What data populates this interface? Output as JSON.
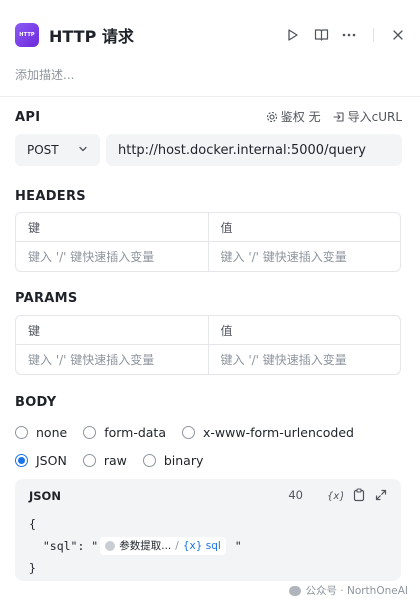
{
  "header": {
    "app_icon_text": "HTTP",
    "title": "HTTP 请求",
    "icons": [
      "play-icon",
      "book-icon",
      "more-icon",
      "close-icon"
    ]
  },
  "description_placeholder": "添加描述...",
  "api": {
    "title": "API",
    "auth_label": "鉴权 无",
    "import_label": "导入cURL",
    "method": "POST",
    "url": "http://host.docker.internal:5000/query"
  },
  "headers": {
    "title": "HEADERS",
    "col_key": "键",
    "col_value": "值",
    "key_placeholder": "键入 '/' 键快速插入变量",
    "value_placeholder": "键入 '/' 键快速插入变量"
  },
  "params": {
    "title": "PARAMS",
    "col_key": "键",
    "col_value": "值",
    "key_placeholder": "键入 '/' 键快速插入变量",
    "value_placeholder": "键入 '/' 键快速插入变量"
  },
  "body": {
    "title": "BODY",
    "options_row1": [
      "none",
      "form-data",
      "x-www-form-urlencoded"
    ],
    "options_row2": [
      "JSON",
      "raw",
      "binary"
    ],
    "selected": "JSON",
    "editor": {
      "title": "JSON",
      "count": "40",
      "line1": "{",
      "line2_prefix": "  \"sql\": \"",
      "chip_node": "参数提取...",
      "chip_sep": "/",
      "chip_var": "{x} sql",
      "line2_suffix": " \"",
      "line3": "}"
    }
  },
  "watermark": "公众号 · NorthOneAI",
  "colors": {
    "accent": "#1a73e8",
    "brand": "#7c3aed"
  }
}
